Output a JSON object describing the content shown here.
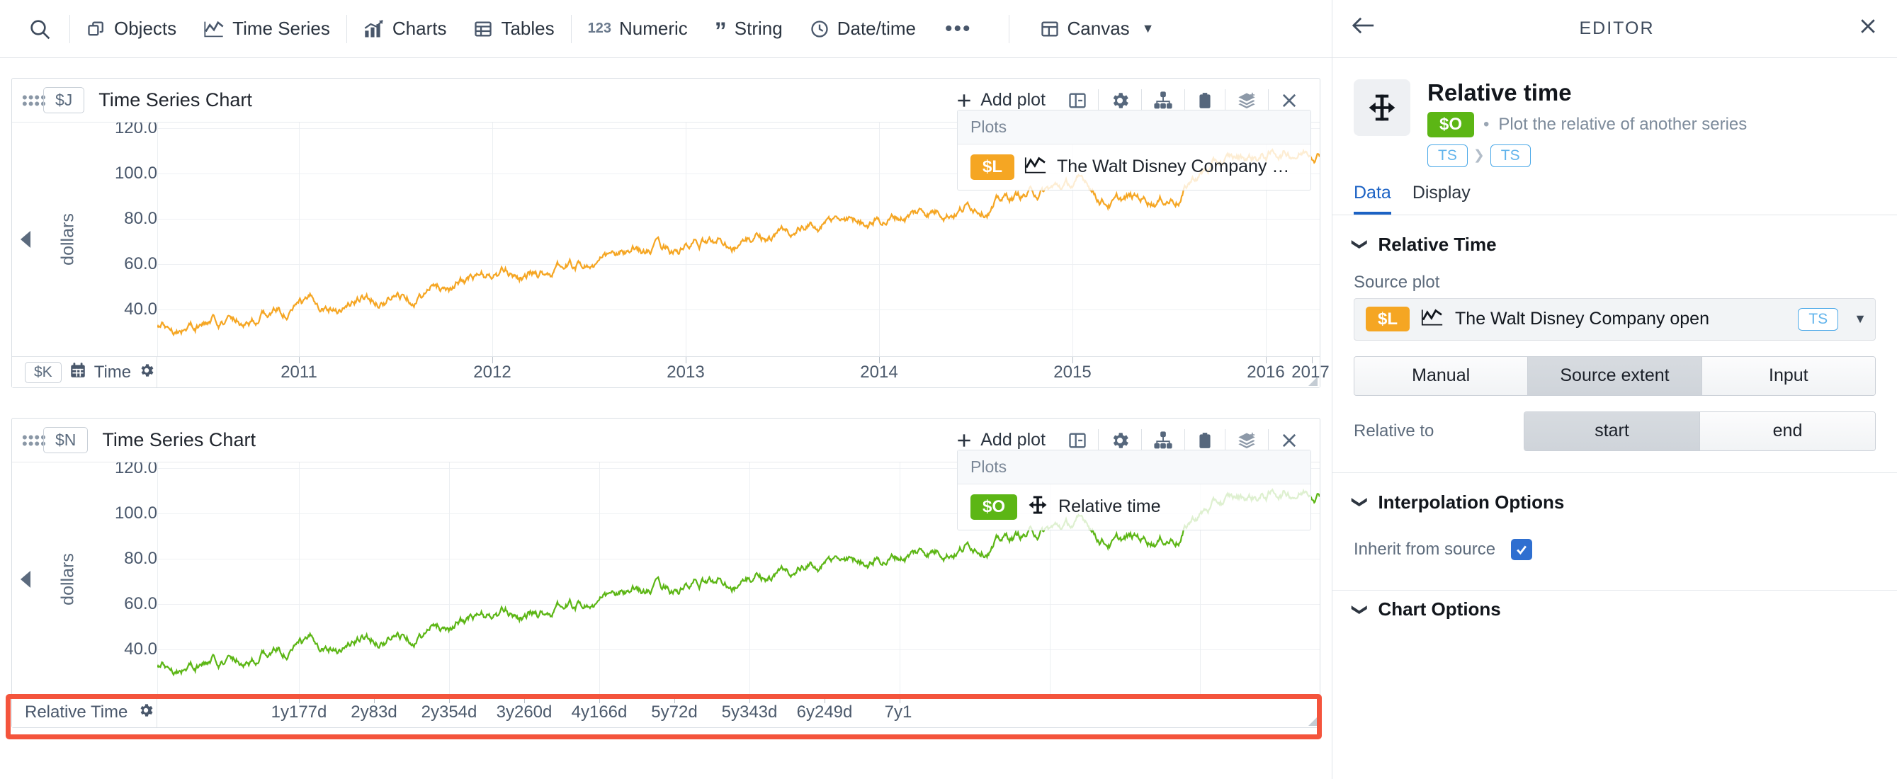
{
  "toolbar": {
    "search_icon": "search-icon",
    "items": [
      {
        "label": "Objects",
        "icon": "objects-icon"
      },
      {
        "label": "Time Series",
        "icon": "timeseries-icon"
      },
      {
        "label": "Charts",
        "icon": "charts-icon"
      },
      {
        "label": "Tables",
        "icon": "tables-icon"
      },
      {
        "label": "Numeric",
        "icon": "numeric-icon"
      },
      {
        "label": "String",
        "icon": "string-icon"
      },
      {
        "label": "Date/time",
        "icon": "clock-icon"
      }
    ],
    "overflow": "•••",
    "canvas": {
      "label": "Canvas",
      "icon": "canvas-icon",
      "caret": "▼"
    }
  },
  "chart1": {
    "badge": "$J",
    "title": "Time Series Chart",
    "add_plot": "Add plot",
    "icons": [
      "panel-toggle-icon",
      "gear-icon",
      "hierarchy-icon",
      "clipboard-icon",
      "layers-add-icon",
      "close-icon"
    ],
    "plots_popup": {
      "header": "Plots",
      "rows": [
        {
          "tag": "$L",
          "tag_color": "#f5a623",
          "icon": "line-chart-icon",
          "label": "The Walt Disney Company op..."
        }
      ]
    },
    "yaxis": {
      "label": "dollars",
      "ticks": [
        "120.0",
        "100.0",
        "80.0",
        "60.0",
        "40.0"
      ]
    },
    "xaxis": {
      "badge": "$K",
      "label": "Time",
      "gear": "gear-icon",
      "ticks": [
        "2011",
        "2012",
        "2013",
        "2014",
        "2015",
        "2016",
        "2017"
      ]
    },
    "series_color": "#f5a623"
  },
  "chart2": {
    "badge": "$N",
    "title": "Time Series Chart",
    "add_plot": "Add plot",
    "icons": [
      "panel-toggle-icon",
      "gear-icon",
      "hierarchy-icon",
      "clipboard-icon",
      "layers-add-icon",
      "close-icon"
    ],
    "plots_popup": {
      "header": "Plots",
      "rows": [
        {
          "tag": "$O",
          "tag_color": "#5cb615",
          "icon": "relative-time-icon",
          "label": "Relative time"
        }
      ]
    },
    "yaxis": {
      "label": "dollars",
      "ticks": [
        "120.0",
        "100.0",
        "80.0",
        "60.0",
        "40.0"
      ]
    },
    "xaxis": {
      "label": "Relative Time",
      "gear": "gear-icon",
      "ticks": [
        "1y177d",
        "2y83d",
        "2y354d",
        "3y260d",
        "4y166d",
        "5y72d",
        "5y343d",
        "6y249d",
        "7y1"
      ]
    },
    "series_color": "#5cb615",
    "highlight_color": "#f4543c"
  },
  "editor": {
    "back_icon": "back-arrow-icon",
    "title": "EDITOR",
    "close_icon": "close-icon",
    "object": {
      "icon": "relative-time-icon",
      "name": "Relative time",
      "tag": "$O",
      "tag_color": "#5cb615",
      "description": "Plot the relative of another series",
      "type_chain": [
        "TS",
        "TS"
      ]
    },
    "tabs": [
      {
        "label": "Data",
        "active": true
      },
      {
        "label": "Display",
        "active": false
      }
    ],
    "sections": [
      {
        "title": "Relative Time",
        "source_plot_label": "Source plot",
        "source_plot": {
          "tag": "$L",
          "tag_color": "#f5a623",
          "icon": "line-chart-icon",
          "label": "The Walt Disney Company open",
          "type_pill": "TS",
          "caret": "▼"
        },
        "extent_segments": [
          {
            "label": "Manual",
            "selected": false
          },
          {
            "label": "Source extent",
            "selected": true
          },
          {
            "label": "Input",
            "selected": false
          }
        ],
        "relative_to_label": "Relative to",
        "relative_to_segments": [
          {
            "label": "start",
            "selected": true
          },
          {
            "label": "end",
            "selected": false
          }
        ]
      },
      {
        "title": "Interpolation Options",
        "inherit_label": "Inherit from source",
        "inherit_checked": true
      },
      {
        "title": "Chart Options"
      }
    ]
  },
  "colors": {
    "accent": "#1c62c4",
    "orange": "#f5a623",
    "green": "#5cb615",
    "highlight": "#f4543c"
  }
}
